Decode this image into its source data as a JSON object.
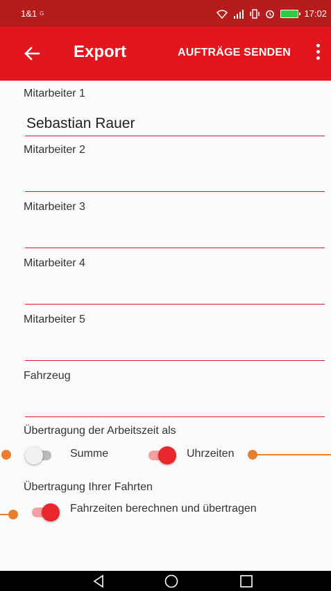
{
  "status_bar": {
    "carrier": "1&1",
    "network": "G",
    "time": "17:02"
  },
  "app_bar": {
    "title": "Export",
    "send_label": "AUFTRÄGE SENDEN"
  },
  "fields": [
    {
      "label": "Mitarbeiter 1",
      "value": "Sebastian Rauer"
    },
    {
      "label": "Mitarbeiter 2",
      "value": ""
    },
    {
      "label": "Mitarbeiter 3",
      "value": ""
    },
    {
      "label": "Mitarbeiter 4",
      "value": ""
    },
    {
      "label": "Mitarbeiter 5",
      "value": ""
    },
    {
      "label": "Fahrzeug",
      "value": ""
    }
  ],
  "worktime": {
    "label": "Übertragung der Arbeitszeit als",
    "option_sum": {
      "label": "Summe",
      "on": false
    },
    "option_times": {
      "label": "Uhrzeiten",
      "on": true
    }
  },
  "trips": {
    "label": "Übertragung Ihrer Fahrten",
    "option_calc": {
      "label": "Fahrzeiten berechnen und übertragen",
      "on": true
    }
  },
  "colors": {
    "status_bar": "#b71c1c",
    "app_bar": "#e2161c",
    "accent": "#e8262c",
    "callout": "#e87f2e",
    "nav_bar": "#000000"
  },
  "icons": {
    "back": "arrow-left-icon",
    "menu": "more-vert-icon",
    "nav_back": "triangle-back-icon",
    "nav_home": "circle-home-icon",
    "nav_recents": "square-recents-icon"
  }
}
